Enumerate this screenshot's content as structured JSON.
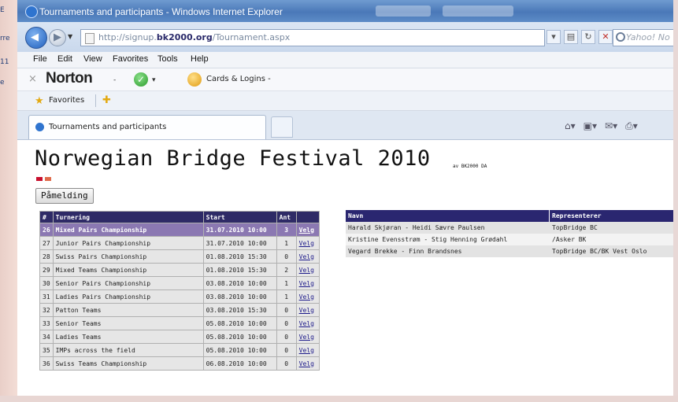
{
  "window": {
    "title": "Tournaments and participants - Windows Internet Explorer"
  },
  "address_bar": {
    "url_prefix": "http://signup.",
    "url_domain": "bk2000.org",
    "url_path": "/Tournament.aspx",
    "search_placeholder": "Yahoo! No"
  },
  "menu": {
    "items": [
      "File",
      "Edit",
      "View",
      "Favorites",
      "Tools",
      "Help"
    ]
  },
  "norton": {
    "logo": "Norton",
    "dropdown": "-",
    "cards_label": "Cards & Logins  -"
  },
  "favorites": {
    "label": "Favorites"
  },
  "tabs": {
    "active_label": "Tournaments and participants"
  },
  "page": {
    "title": "Norwegian Bridge Festival 2010",
    "title_by": "av BK2000 DA",
    "signup_button": "Påmelding",
    "flag_colors": [
      "#c8102e",
      "#e06a4a"
    ]
  },
  "tournaments": {
    "headers": {
      "num": "#",
      "name": "Turnering",
      "start": "Start",
      "count": "Ant",
      "action": ""
    },
    "rows": [
      {
        "num": "26",
        "name": "Mixed Pairs Championship",
        "start": "31.07.2010 10:00",
        "count": "3",
        "action": "Velg",
        "selected": true
      },
      {
        "num": "27",
        "name": "Junior Pairs Championship",
        "start": "31.07.2010 10:00",
        "count": "1",
        "action": "Velg",
        "selected": false
      },
      {
        "num": "28",
        "name": "Swiss Pairs Championship",
        "start": "01.08.2010 15:30",
        "count": "0",
        "action": "Velg",
        "selected": false
      },
      {
        "num": "29",
        "name": "Mixed Teams Championship",
        "start": "01.08.2010 15:30",
        "count": "2",
        "action": "Velg",
        "selected": false
      },
      {
        "num": "30",
        "name": "Senior Pairs Championship",
        "start": "03.08.2010 10:00",
        "count": "1",
        "action": "Velg",
        "selected": false
      },
      {
        "num": "31",
        "name": "Ladies Pairs Championship",
        "start": "03.08.2010 10:00",
        "count": "1",
        "action": "Velg",
        "selected": false
      },
      {
        "num": "32",
        "name": "Patton Teams",
        "start": "03.08.2010 15:30",
        "count": "0",
        "action": "Velg",
        "selected": false
      },
      {
        "num": "33",
        "name": "Senior Teams",
        "start": "05.08.2010 10:00",
        "count": "0",
        "action": "Velg",
        "selected": false
      },
      {
        "num": "34",
        "name": "Ladies Teams",
        "start": "05.08.2010 10:00",
        "count": "0",
        "action": "Velg",
        "selected": false
      },
      {
        "num": "35",
        "name": "IMPs across the field",
        "start": "05.08.2010 10:00",
        "count": "0",
        "action": "Velg",
        "selected": false
      },
      {
        "num": "36",
        "name": "Swiss Teams Championship",
        "start": "06.08.2010 10:00",
        "count": "0",
        "action": "Velg",
        "selected": false
      }
    ]
  },
  "participants": {
    "headers": {
      "name": "Navn",
      "represents": "Representerer"
    },
    "rows": [
      {
        "name": "Harald Skjøran - Heidi Sævre Paulsen",
        "represents": "TopBridge BC"
      },
      {
        "name": "Kristine Evensstrøm - Stig Henning Grødahl",
        "represents": "/Asker BK"
      },
      {
        "name": "Vegard Brekke - Finn Brandsnes",
        "represents": "TopBridge BC/BK Vest Oslo"
      }
    ]
  },
  "desktop": {
    "side_labels": [
      "E",
      "rre",
      "11",
      "e"
    ]
  }
}
